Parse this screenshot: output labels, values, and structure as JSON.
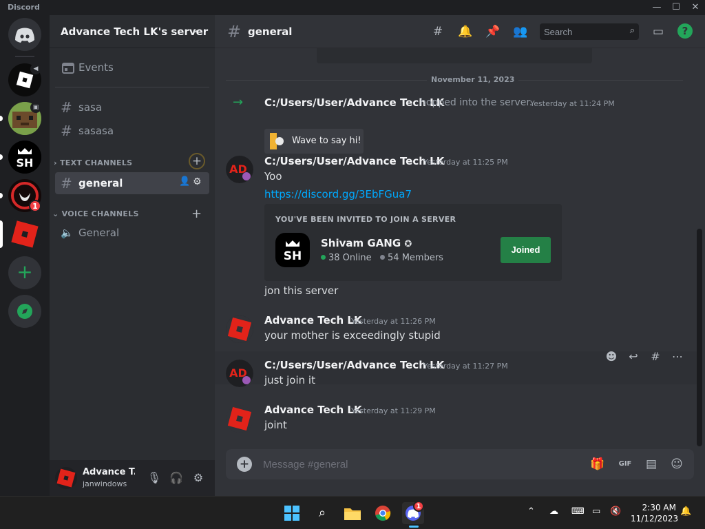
{
  "app": {
    "title": "Discord",
    "win_min": "—",
    "win_max": "☐",
    "win_close": "✕"
  },
  "servers": [
    {
      "name": "Direct Messages",
      "icon": "discord-logo-icon",
      "color": "#4e5058"
    },
    {
      "name": "Roblox server",
      "icon": "roblox-icon"
    },
    {
      "name": "Minecraft server",
      "icon": "minecraft-icon"
    },
    {
      "name": "Shivam GANG",
      "icon": "sh-logo-icon"
    },
    {
      "name": "Red server",
      "icon": "red-logo-icon",
      "badge": "1"
    },
    {
      "name": "Advance Tech LK's server",
      "icon": "roblox-red-icon",
      "active": true
    }
  ],
  "add_server": "+",
  "explore": "explore-icon",
  "sidebar": {
    "guild_name": "Advance Tech LK's server",
    "events": "Events",
    "channels_top": [
      {
        "name": "sasa"
      },
      {
        "name": "sasasa"
      }
    ],
    "text_category": "TEXT CHANNELS",
    "text_channels": [
      {
        "name": "general",
        "active": true
      }
    ],
    "voice_category": "VOICE CHANNELS",
    "voice_channels": [
      {
        "name": "General"
      }
    ]
  },
  "user": {
    "display_name": "Advance T...",
    "username": "janwindows"
  },
  "channel": {
    "name": "general"
  },
  "search": {
    "placeholder": "Search"
  },
  "date_divider": "November 11, 2023",
  "messages": [
    {
      "type": "join",
      "author": "C:/Users/User/Advance Tech LK",
      "text": "hopped into the server.",
      "timestamp": "Yesterday at 11:24 PM",
      "button": "Wave to say hi!"
    },
    {
      "author": "C:/Users/User/Advance Tech LK",
      "timestamp": "Yesterday at 11:25 PM",
      "lines": [
        "Yoo",
        "https://discord.gg/3EbFGua7"
      ],
      "invite": {
        "heading": "YOU'VE BEEN INVITED TO JOIN A SERVER",
        "guild": "Shivam GANG",
        "online": "38 Online",
        "members": "54 Members",
        "button": "Joined"
      },
      "after": "jon this server"
    },
    {
      "author": "Advance Tech LK",
      "timestamp": "Yesterday at 11:26 PM",
      "lines": [
        "your mother is exceedingly stupid"
      ]
    },
    {
      "author": "C:/Users/User/Advance Tech LK",
      "timestamp": "Yesterday at 11:27 PM",
      "lines": [
        "just join it"
      ]
    },
    {
      "author": "Advance Tech LK",
      "timestamp": "Yesterday at 11:29 PM",
      "lines": [
        "joint"
      ]
    }
  ],
  "composer": {
    "placeholder": "Message #general",
    "gif": "GIF"
  },
  "taskbar": {
    "time": "2:30 AM",
    "date": "11/12/2023",
    "discord_badge": "1"
  },
  "colors": {
    "accent": "#5865f2",
    "green": "#23a55a",
    "link": "#00a8fc",
    "join_arrow": "#23a55a"
  }
}
